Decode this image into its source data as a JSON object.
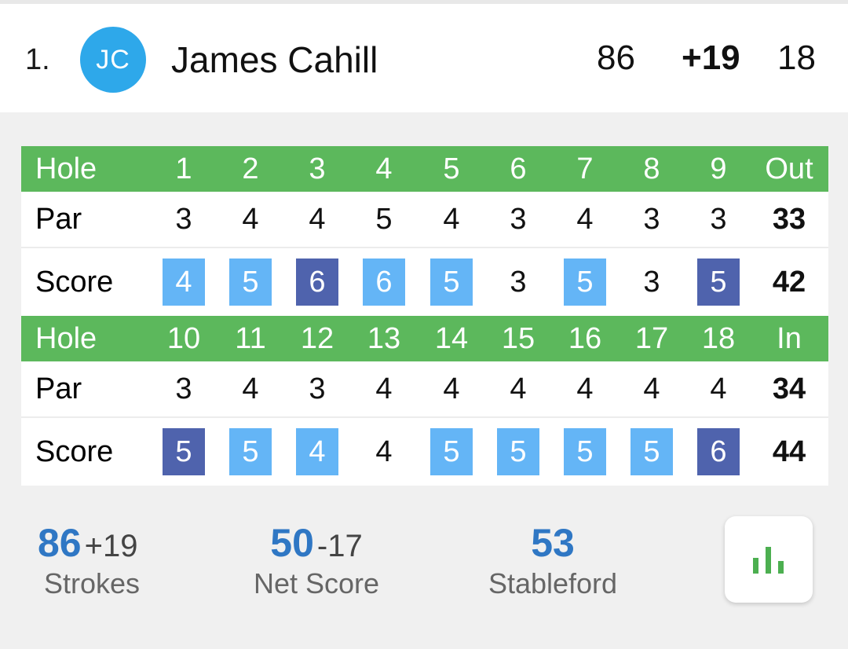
{
  "player": {
    "rank": "1.",
    "initials": "JC",
    "name": "James Cahill",
    "strokes": "86",
    "to_par": "+19",
    "thru": "18"
  },
  "front_nine": {
    "hole_label": "Hole",
    "par_label": "Par",
    "score_label": "Score",
    "holes": [
      "1",
      "2",
      "3",
      "4",
      "5",
      "6",
      "7",
      "8",
      "9"
    ],
    "total_label": "Out",
    "pars": [
      "3",
      "4",
      "4",
      "5",
      "4",
      "3",
      "4",
      "3",
      "3"
    ],
    "par_total": "33",
    "scores": [
      "4",
      "5",
      "6",
      "6",
      "5",
      "3",
      "5",
      "3",
      "5"
    ],
    "score_types": [
      "bogey",
      "bogey",
      "double",
      "bogey",
      "bogey",
      "par",
      "bogey",
      "par",
      "double"
    ],
    "score_total": "42"
  },
  "back_nine": {
    "hole_label": "Hole",
    "par_label": "Par",
    "score_label": "Score",
    "holes": [
      "10",
      "11",
      "12",
      "13",
      "14",
      "15",
      "16",
      "17",
      "18"
    ],
    "total_label": "In",
    "pars": [
      "3",
      "4",
      "3",
      "4",
      "4",
      "4",
      "4",
      "4",
      "4"
    ],
    "par_total": "34",
    "scores": [
      "5",
      "5",
      "4",
      "4",
      "5",
      "5",
      "5",
      "5",
      "6"
    ],
    "score_types": [
      "double",
      "bogey",
      "bogey",
      "par",
      "bogey",
      "bogey",
      "bogey",
      "bogey",
      "double"
    ],
    "score_total": "44"
  },
  "summary": {
    "strokes_value": "86",
    "strokes_diff": "+19",
    "strokes_label": "Strokes",
    "net_value": "50",
    "net_diff": "-17",
    "net_label": "Net Score",
    "stableford_value": "53",
    "stableford_label": "Stableford"
  },
  "chart_button": {
    "icon": "bar-chart-icon"
  },
  "colors": {
    "header_green": "#5cb85c",
    "bogey_blue": "#64b5f6",
    "double_bogey_blue": "#4f63ad",
    "avatar_blue": "#2ea8ea",
    "stat_blue": "#2f77c4"
  }
}
